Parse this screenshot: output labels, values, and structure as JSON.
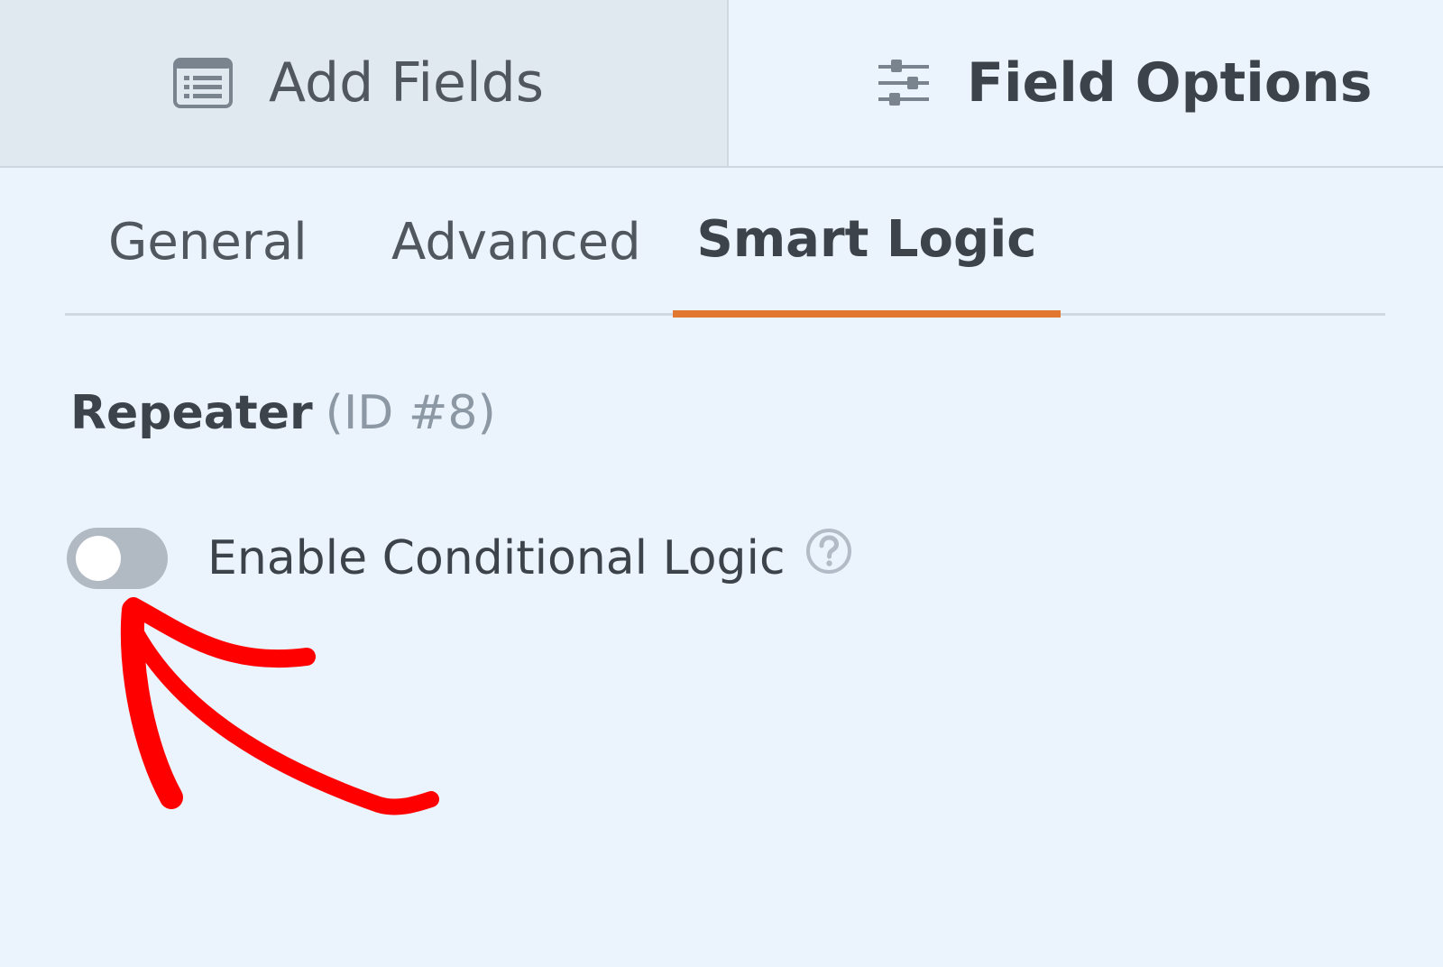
{
  "top_tabs": {
    "add_fields": {
      "label": "Add Fields",
      "icon": "list-form-icon"
    },
    "field_options": {
      "label": "Field Options",
      "icon": "sliders-icon"
    }
  },
  "sub_tabs": [
    {
      "label": "General",
      "active": false
    },
    {
      "label": "Advanced",
      "active": false
    },
    {
      "label": "Smart Logic",
      "active": true
    }
  ],
  "field": {
    "name": "Repeater",
    "id_text": "(ID #8)"
  },
  "conditional_logic": {
    "label": "Enable Conditional Logic",
    "enabled": false,
    "help_icon": "question-circle-icon"
  },
  "colors": {
    "background": "#ebf3fc",
    "active_tab_underline": "#e27730",
    "toggle_off": "#b1b9c2",
    "annotation": "#ff0000"
  }
}
